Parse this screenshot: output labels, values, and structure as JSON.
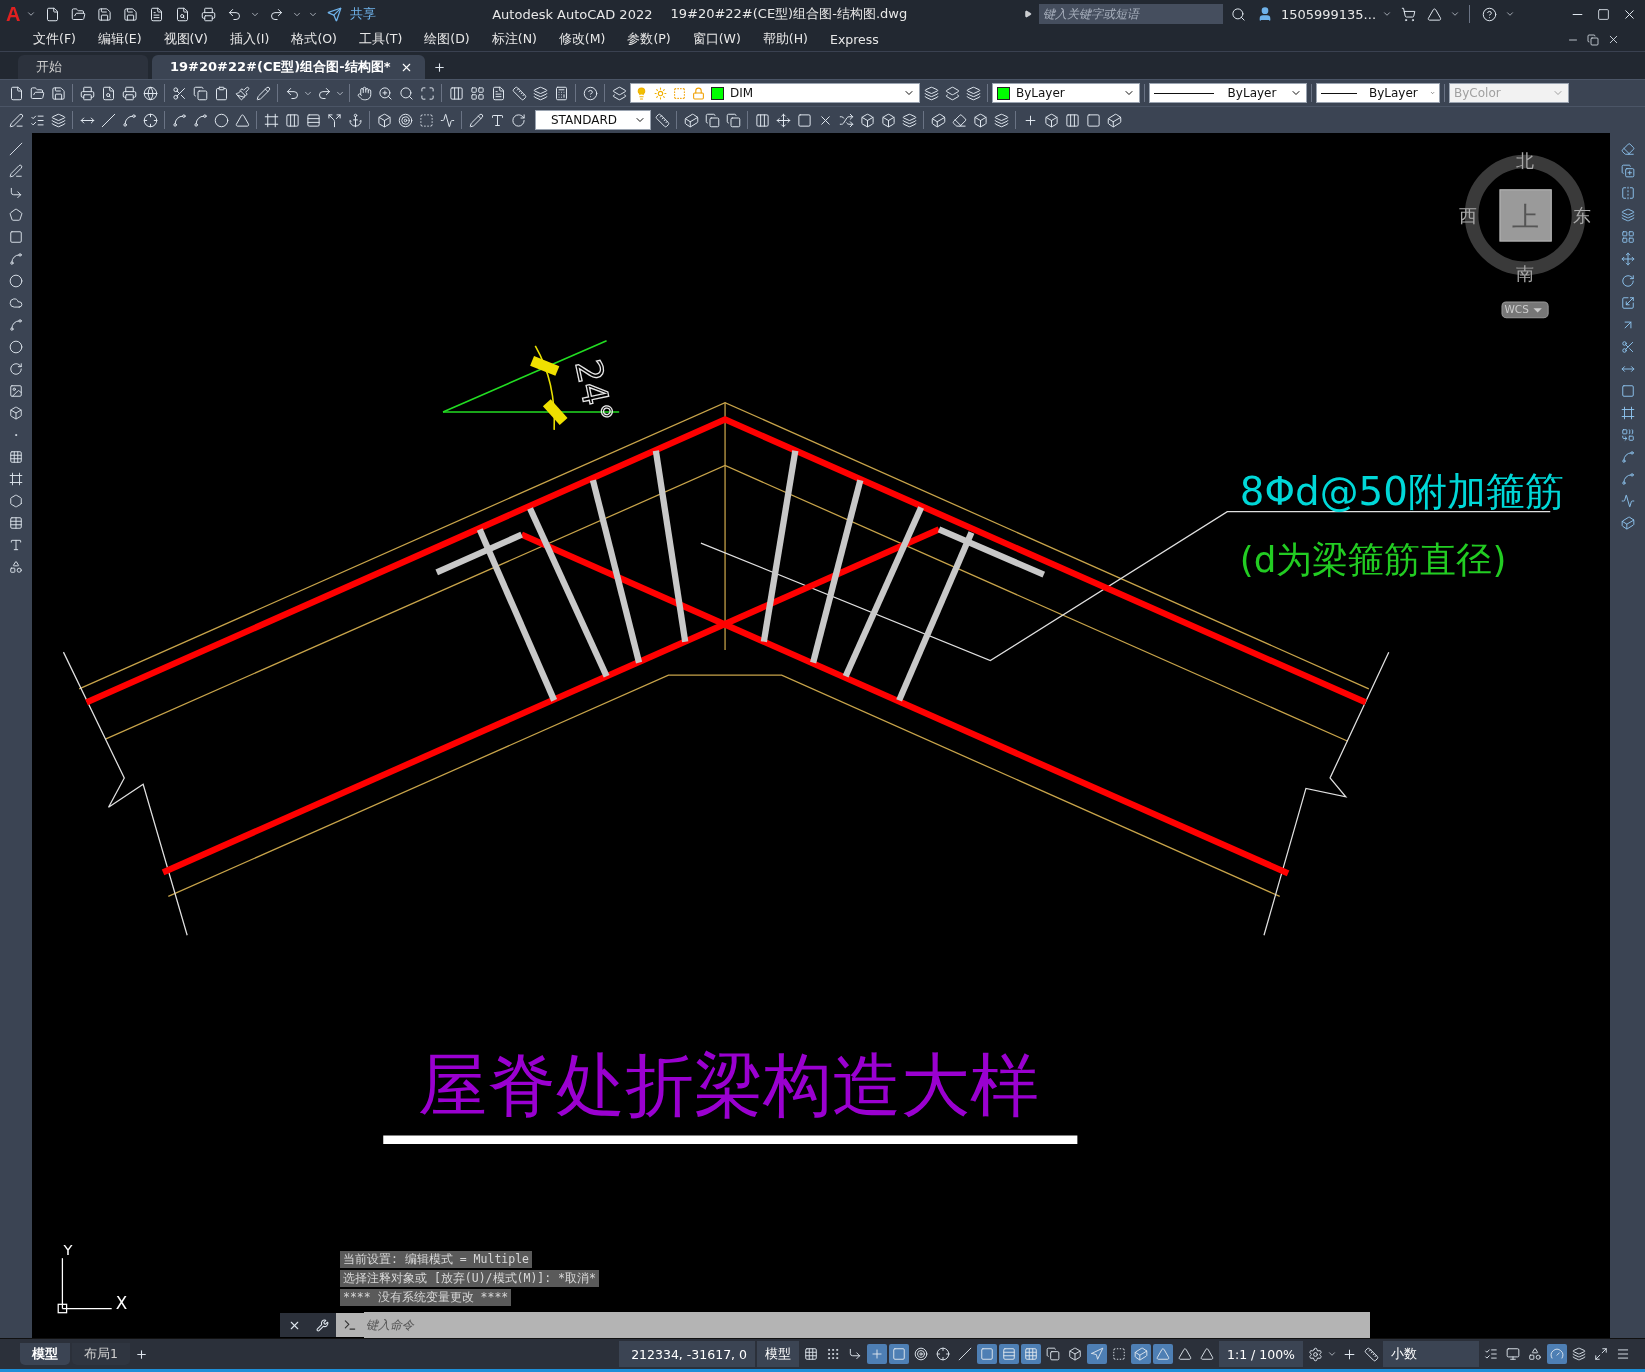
{
  "title_bar": {
    "logo": "A",
    "share": "共享",
    "app_title": "Autodesk AutoCAD 2022",
    "file_title": "19#20#22#(CE型)组合图-结构图.dwg",
    "search": {
      "placeholder": "键入关键字或短语"
    },
    "user": "1505999135..."
  },
  "menu": [
    "文件(F)",
    "编辑(E)",
    "视图(V)",
    "插入(I)",
    "格式(O)",
    "工具(T)",
    "绘图(D)",
    "标注(N)",
    "修改(M)",
    "参数(P)",
    "窗口(W)",
    "帮助(H)",
    "Express"
  ],
  "tabs": [
    {
      "label": "开始",
      "selected": false
    },
    {
      "label": "19#20#22#(CE型)组合图-结构图*",
      "selected": true
    }
  ],
  "toolbar": {
    "layer": "DIM",
    "color_setting": "ByLayer",
    "linetype": "ByLayer",
    "lineweight": "ByLayer",
    "plot_style": {
      "value": "ByColor",
      "disabled": true
    },
    "text_style": "STANDARD"
  },
  "drawing": {
    "angle": "24°",
    "note_1": "8Φd@50附加箍筋",
    "note_2": "(d为梁箍筋直径)",
    "title": "屋脊处折梁构造大样"
  },
  "viewcube": {
    "north": "北",
    "west": "西",
    "face": "上",
    "east": "东",
    "south": "南",
    "coordinate_system": "WCS"
  },
  "ucs": {
    "y": "Y",
    "x": "X"
  },
  "command_history": [
    "当前设置: 编辑模式 = Multiple",
    "选择注释对象或 [放弃(U)/模式(M)]: *取消*",
    "**** 没有系统变量更改 ****"
  ],
  "command_line": {
    "placeholder": "键入命令"
  },
  "layout_tabs": [
    {
      "label": "模型",
      "selected": true
    },
    {
      "label": "布局1",
      "selected": false
    }
  ],
  "status_bar": {
    "coordinates": "212334, -31617, 0",
    "space": "模型",
    "scale": "1:1 / 100%",
    "units": "小数"
  },
  "status_toggles": [
    {
      "on": false
    },
    {
      "on": false
    },
    {
      "on": false
    },
    {
      "on": true
    },
    {
      "on": true
    },
    {
      "on": false
    },
    {
      "on": false
    },
    {
      "on": false
    },
    {
      "on": true
    },
    {
      "on": true
    },
    {
      "on": true
    },
    {
      "on": false
    },
    {
      "on": false
    },
    {
      "on": true
    },
    {
      "on": false
    },
    {
      "on": true
    },
    {
      "on": true
    },
    {
      "on": false
    },
    {
      "on": false
    }
  ],
  "status_toggles_end": [
    {
      "on": false
    },
    {
      "on": false
    },
    {
      "on": false
    },
    {
      "on": true
    },
    {
      "on": false
    },
    {
      "on": false
    },
    {
      "on": false
    }
  ]
}
